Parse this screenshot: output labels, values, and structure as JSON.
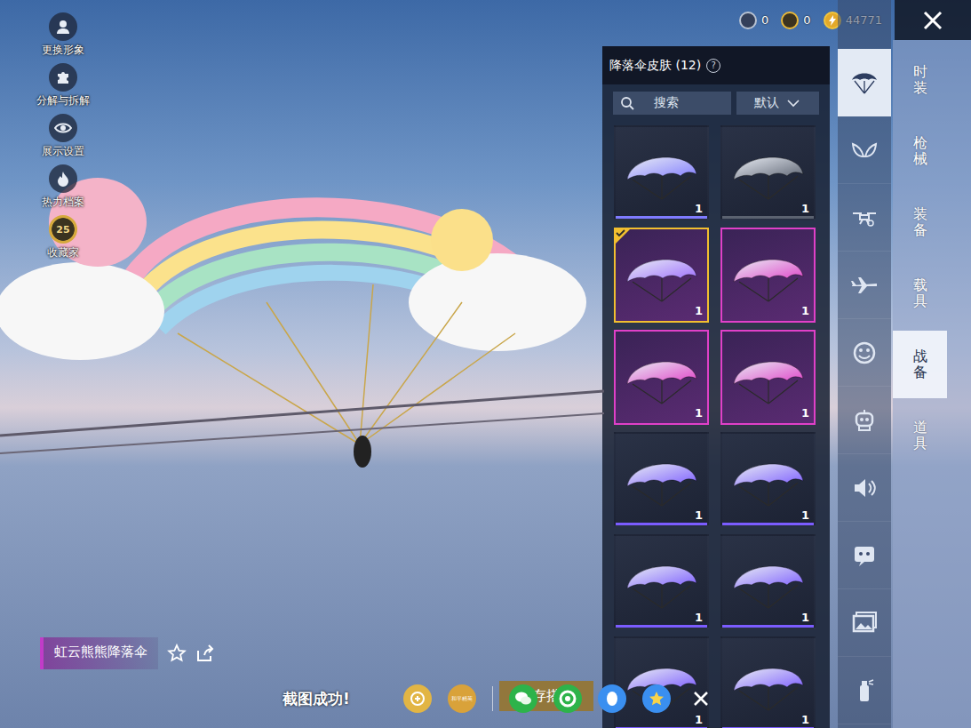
{
  "currencies": [
    {
      "kind": "silver",
      "amount": "0"
    },
    {
      "kind": "gold",
      "amount": "0"
    },
    {
      "kind": "bolt",
      "amount": "44771"
    }
  ],
  "side_menu": [
    {
      "label": "更换形象",
      "kind": "avatar"
    },
    {
      "label": "分解与拆解",
      "kind": "puzzle"
    },
    {
      "label": "展示设置",
      "kind": "eye"
    },
    {
      "label": "热力档案",
      "kind": "flame"
    },
    {
      "label": "收藏家",
      "kind": "collector",
      "badge": "25"
    }
  ],
  "panel": {
    "title": "降落伞皮肤 (12)",
    "help": "?",
    "search_placeholder": "搜索",
    "sort": "默认"
  },
  "items": [
    {
      "count": "1",
      "selected": false,
      "kind": "plain",
      "color": "#7f7bff"
    },
    {
      "count": "1",
      "selected": false,
      "kind": "plain",
      "color": "#5b6270"
    },
    {
      "count": "1",
      "selected": true,
      "kind": "plain",
      "color": "#9c6bff"
    },
    {
      "count": "1",
      "selected": false,
      "kind": "framed",
      "color": "#e040c8"
    },
    {
      "count": "1",
      "selected": false,
      "kind": "framed",
      "color": "#e040c8"
    },
    {
      "count": "1",
      "selected": false,
      "kind": "framed",
      "color": "#e040c8"
    },
    {
      "count": "1",
      "selected": false,
      "kind": "plain",
      "color": "#7b5cff"
    },
    {
      "count": "1",
      "selected": false,
      "kind": "plain",
      "color": "#7b5cff"
    },
    {
      "count": "1",
      "selected": false,
      "kind": "plain",
      "color": "#7b5cff"
    },
    {
      "count": "1",
      "selected": false,
      "kind": "plain",
      "color": "#7b5cff"
    },
    {
      "count": "1",
      "selected": false,
      "kind": "plain",
      "color": "#7b5cff"
    },
    {
      "count": "1",
      "selected": false,
      "kind": "plain",
      "color": "#7b5cff"
    }
  ],
  "icon_tabs": [
    {
      "kind": "parachute",
      "selected": true
    },
    {
      "kind": "wings",
      "selected": false
    },
    {
      "kind": "drone",
      "selected": false
    },
    {
      "kind": "plane",
      "selected": false
    },
    {
      "kind": "emote",
      "selected": false
    },
    {
      "kind": "robot",
      "selected": false
    },
    {
      "kind": "speaker",
      "selected": false
    },
    {
      "kind": "chat",
      "selected": false
    },
    {
      "kind": "picture",
      "selected": false
    },
    {
      "kind": "spray",
      "selected": false
    }
  ],
  "categories": [
    {
      "label": "时装",
      "selected": false
    },
    {
      "label": "枪械",
      "selected": false
    },
    {
      "label": "装备",
      "selected": false
    },
    {
      "label": "载具",
      "selected": false
    },
    {
      "label": "战备",
      "selected": true
    },
    {
      "label": "道具",
      "selected": false
    }
  ],
  "showcase": {
    "name": "虹云熊熊降落伞"
  },
  "save_button": "保存搭配",
  "screenshot": {
    "message": "截图成功!",
    "share": [
      {
        "kind": "gold"
      },
      {
        "kind": "logo",
        "label": "和平精英"
      },
      {
        "kind": "wechat"
      },
      {
        "kind": "moments"
      },
      {
        "kind": "qq"
      },
      {
        "kind": "qzone"
      },
      {
        "kind": "close"
      }
    ]
  }
}
